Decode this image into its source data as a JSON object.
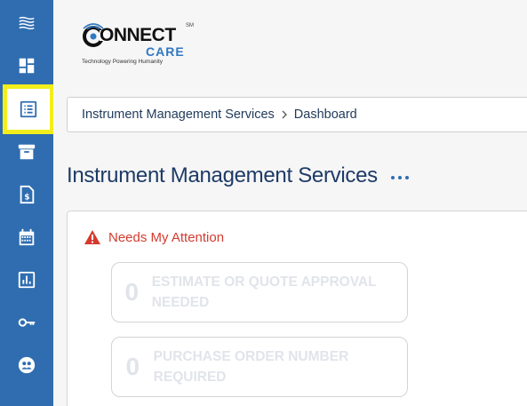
{
  "sidebar": {
    "items": [
      {
        "name": "menu-icon"
      },
      {
        "name": "dashboard-icon"
      },
      {
        "name": "list-icon",
        "active": true
      },
      {
        "name": "archive-icon"
      },
      {
        "name": "invoice-icon"
      },
      {
        "name": "calendar-icon"
      },
      {
        "name": "reports-icon"
      },
      {
        "name": "key-icon"
      },
      {
        "name": "user-circle-icon"
      }
    ],
    "accent": "#2f6db0",
    "highlight": "#f2ee1b"
  },
  "logo": {
    "word1": "ONNECT",
    "word2": "CARE",
    "sm": "SM",
    "tagline": "Technology Powering Humanity"
  },
  "breadcrumb": {
    "items": [
      "Instrument Management Services",
      "Dashboard"
    ]
  },
  "page": {
    "title": "Instrument Management Services"
  },
  "attention": {
    "heading": "Needs My Attention",
    "cards": [
      {
        "count": "0",
        "label": "Estimate or Quote Approval Needed"
      },
      {
        "count": "0",
        "label": "Purchase Order Number Required"
      }
    ],
    "color": "#d33b2f"
  }
}
